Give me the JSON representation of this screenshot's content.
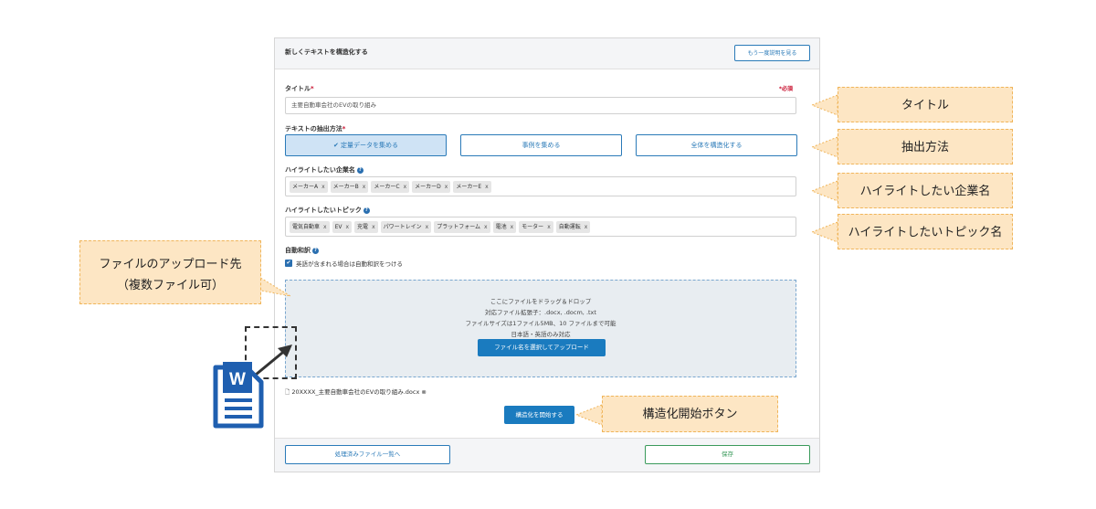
{
  "panel": {
    "title": "新しくテキストを構造化する",
    "explain_button": "もう一度説明を見る",
    "required_note": "*必須"
  },
  "form": {
    "title_label": "タイトル",
    "title_required_mark": "*",
    "title_value": "主要自動車会社のEVの取り組み",
    "method_label": "テキストの抽出方法",
    "method_required_mark": "*",
    "methods": [
      {
        "label": "定量データを集める",
        "selected": true
      },
      {
        "label": "事例を集める",
        "selected": false
      },
      {
        "label": "全体を構造化する",
        "selected": false
      }
    ],
    "company_label": "ハイライトしたい企業名",
    "companies": [
      "メーカーA",
      "メーカーB",
      "メーカーC",
      "メーカーD",
      "メーカーE"
    ],
    "topic_label": "ハイライトしたいトピック",
    "topics": [
      "電気自動車",
      "EV",
      "充電",
      "パワートレイン",
      "プラットフォーム",
      "電池",
      "モーター",
      "自動運転"
    ],
    "tag_remove": "x",
    "translation_label": "自動和訳",
    "translation_checkbox": "英語が含まれる場合は自動和訳をつける",
    "translation_checked": true
  },
  "dropzone": {
    "line1": "ここにファイルをドラッグ＆ドロップ",
    "line2": "対応ファイル拡張子：.docx, .docm, .txt",
    "line3": "ファイルサイズは1ファイル5MB、10 ファイルまで可能",
    "line4": "日本語・英語のみ対応",
    "upload_button": "ファイル名を選択してアップロード"
  },
  "uploaded_file": {
    "name": "20XXXX_主要自動車会社のEVの取り組み.docx",
    "remove_icon": "⊗"
  },
  "start_button": "構造化を開始する",
  "footer": {
    "processed_list_button": "処理済みファイル一覧へ",
    "save_button": "保存"
  },
  "callouts": {
    "title": "タイトル",
    "method": "抽出方法",
    "company": "ハイライトしたい企業名",
    "topic": "ハイライトしたいトピック名",
    "upload_line1": "ファイルのアップロード先",
    "upload_line2": "（複数ファイル可）",
    "start": "構造化開始ボタン"
  },
  "colors": {
    "accent": "#2a7ab8",
    "primary_button": "#1a7bbf",
    "save_green": "#3a9a5b",
    "callout_fill": "#fde6c4",
    "callout_border": "#f0b55a",
    "required_red": "#c8102e",
    "word_icon_blue": "#1f5fb0"
  },
  "icons": {
    "check": "✔",
    "help": "?",
    "file": "🗋"
  }
}
